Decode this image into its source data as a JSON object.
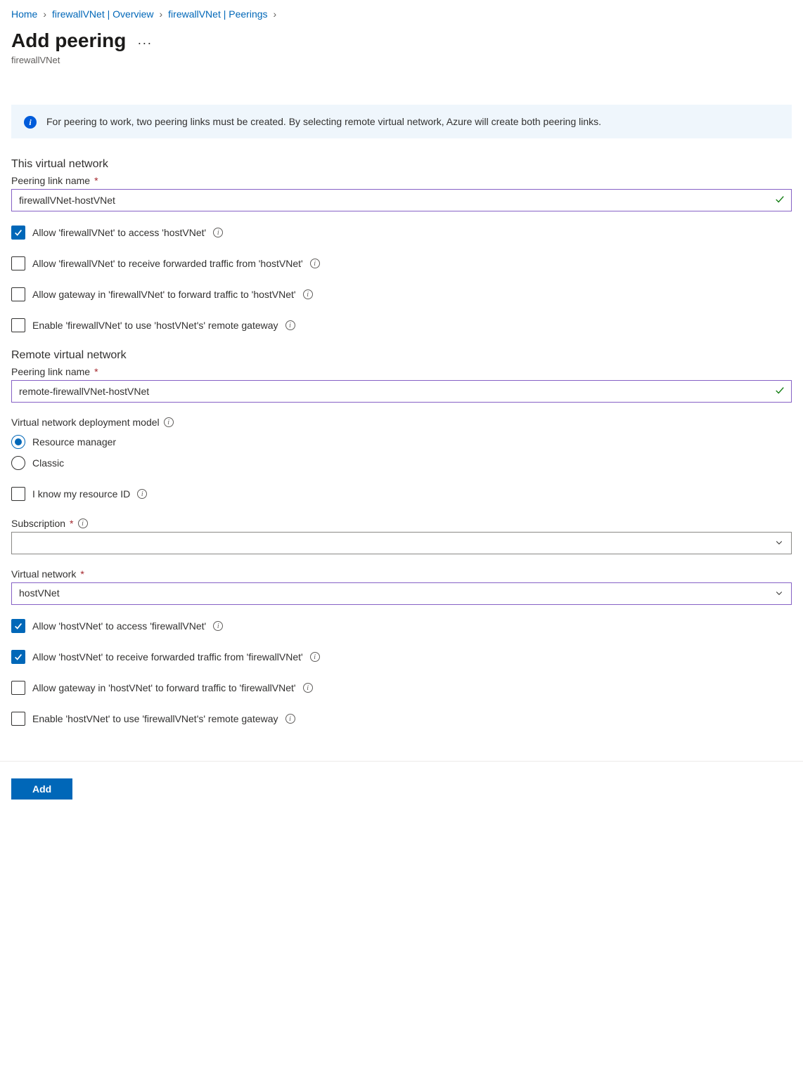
{
  "breadcrumb": {
    "items": [
      "Home",
      "firewallVNet | Overview",
      "firewallVNet | Peerings"
    ]
  },
  "header": {
    "title": "Add peering",
    "subtitle": "firewallVNet"
  },
  "info": {
    "text": "For peering to work, two peering links must be created. By selecting remote virtual network, Azure will create both peering links."
  },
  "thisVnet": {
    "section_title": "This virtual network",
    "link_name_label": "Peering link name",
    "link_name_value": "firewallVNet-hostVNet",
    "opt_access": "Allow 'firewallVNet' to access 'hostVNet'",
    "opt_forwarded": "Allow 'firewallVNet' to receive forwarded traffic from 'hostVNet'",
    "opt_gateway_fwd": "Allow gateway in 'firewallVNet' to forward traffic to 'hostVNet'",
    "opt_remote_gw": "Enable 'firewallVNet' to use 'hostVNet's' remote gateway"
  },
  "remoteVnet": {
    "section_title": "Remote virtual network",
    "link_name_label": "Peering link name",
    "link_name_value": "remote-firewallVNet-hostVNet",
    "model_label": "Virtual network deployment model",
    "model_rm": "Resource manager",
    "model_classic": "Classic",
    "know_id": "I know my resource ID",
    "subscription_label": "Subscription",
    "subscription_value": "",
    "vnet_label": "Virtual network",
    "vnet_value": "hostVNet",
    "opt_access": "Allow 'hostVNet' to access 'firewallVNet'",
    "opt_forwarded": "Allow 'hostVNet' to receive forwarded traffic from 'firewallVNet'",
    "opt_gateway_fwd": "Allow gateway in 'hostVNet' to forward traffic to 'firewallVNet'",
    "opt_remote_gw": "Enable 'hostVNet' to use 'firewallVNet's' remote gateway"
  },
  "footer": {
    "add_label": "Add"
  },
  "checkboxes": {
    "this_access": true,
    "this_forwarded": false,
    "this_gateway_fwd": false,
    "this_remote_gw": false,
    "remote_access": true,
    "remote_forwarded": true,
    "remote_gateway_fwd": false,
    "remote_remote_gw": false,
    "know_id": false
  },
  "radios": {
    "deployment_model": "rm"
  }
}
